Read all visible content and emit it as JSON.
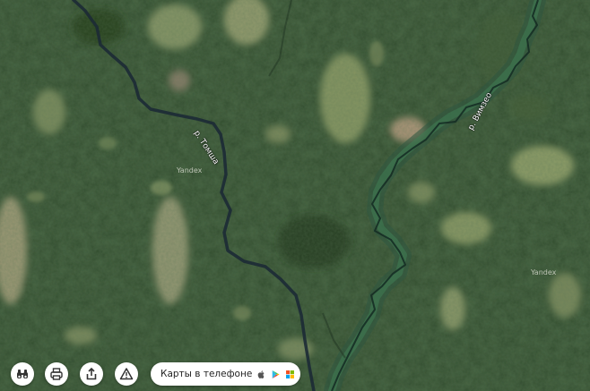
{
  "map": {
    "rivers": [
      {
        "label": "р. Томша"
      },
      {
        "label": "р. Вимзео"
      }
    ],
    "watermarks": [
      "Yandex",
      "Yandex"
    ]
  },
  "controls": {
    "items": [
      {
        "name": "binoculars-button",
        "icon": "binoculars-icon"
      },
      {
        "name": "print-button",
        "icon": "printer-icon"
      },
      {
        "name": "share-button",
        "icon": "share-icon"
      },
      {
        "name": "report-error-button",
        "icon": "warning-icon"
      }
    ],
    "app_banner": {
      "text": "Карты в телефоне",
      "stores": [
        "apple-icon",
        "google-play-icon",
        "windows-icon"
      ]
    }
  }
}
